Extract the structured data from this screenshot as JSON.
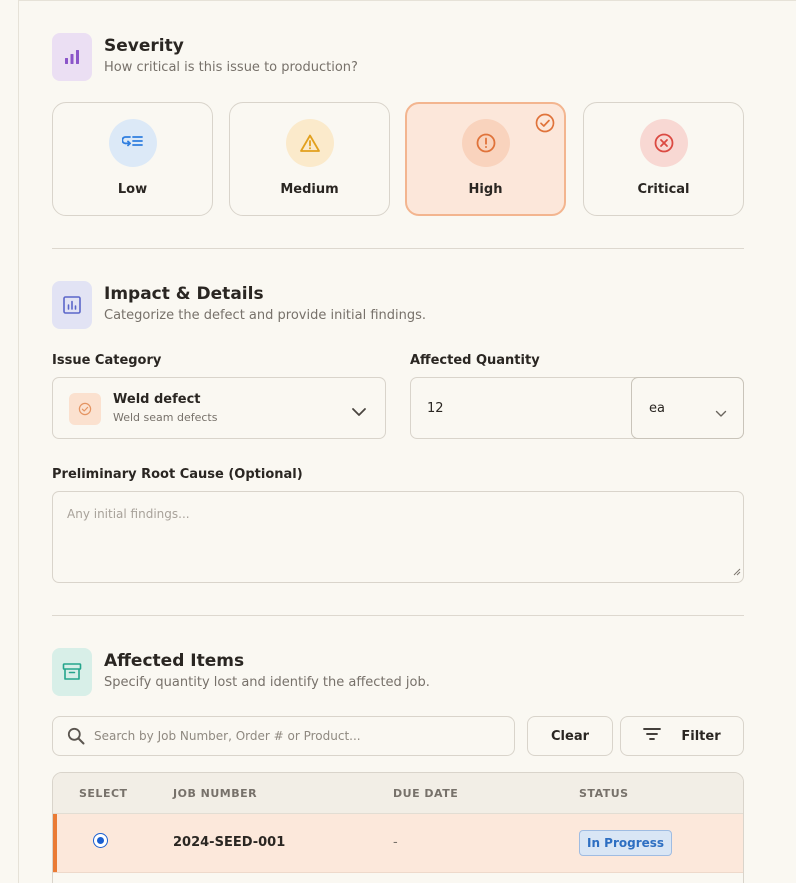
{
  "severity": {
    "title": "Severity",
    "subtitle": "How critical is this issue to production?",
    "selected": "High",
    "options": [
      {
        "label": "Low",
        "icon": "list-low-icon",
        "color": "#2f7ee0",
        "bg": "#dce9f7"
      },
      {
        "label": "Medium",
        "icon": "warning-triangle-icon",
        "color": "#e2a01d",
        "bg": "#fbeacb"
      },
      {
        "label": "High",
        "icon": "exclamation-circle-icon",
        "color": "#e0733a",
        "bg": "#f9d3bd"
      },
      {
        "label": "Critical",
        "icon": "x-circle-icon",
        "color": "#db4a42",
        "bg": "#f8d8d3"
      }
    ]
  },
  "impact": {
    "title": "Impact & Details",
    "subtitle": "Categorize the defect and provide initial findings.",
    "category_label": "Issue Category",
    "category_value": "Weld defect",
    "category_desc": "Weld seam defects",
    "quantity_label": "Affected Quantity",
    "quantity_value": "12",
    "unit_value": "ea",
    "root_cause_label": "Preliminary Root Cause (Optional)",
    "root_cause_placeholder": "Any initial findings..."
  },
  "affected": {
    "title": "Affected Items",
    "subtitle": "Specify quantity lost and identify the affected job.",
    "search_placeholder": "Search by Job Number, Order # or Product...",
    "clear_label": "Clear",
    "filter_label": "Filter",
    "columns": [
      "SELECT",
      "JOB NUMBER",
      "DUE DATE",
      "STATUS"
    ],
    "rows": [
      {
        "job": "2024-SEED-001",
        "due": "-",
        "status": "In Progress",
        "selected": true
      }
    ]
  },
  "colors": {
    "accent": "#ea7b35",
    "selected_bg": "#fce7da",
    "status_blue": "#2e6fc2"
  }
}
